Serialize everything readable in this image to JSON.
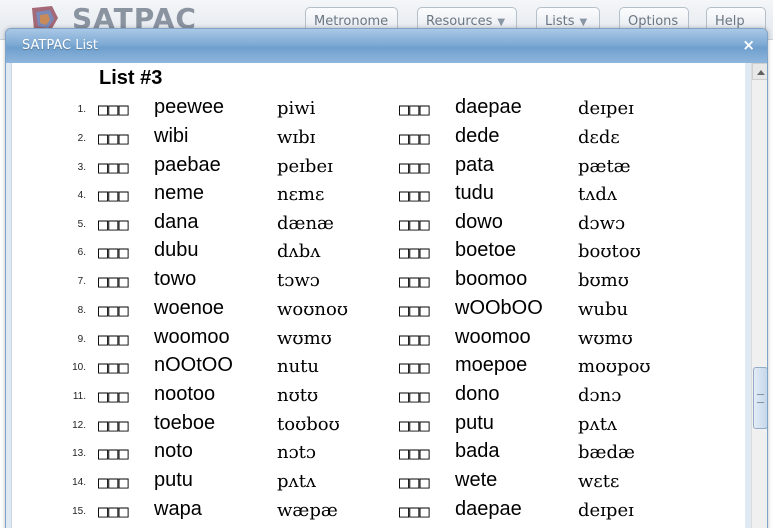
{
  "app": {
    "brand": "SATPAC",
    "nav": [
      {
        "label": "Metronome",
        "caret": ""
      },
      {
        "label": "Resources",
        "caret": "▼"
      },
      {
        "label": "Lists",
        "caret": "▼"
      },
      {
        "label": "Options",
        "caret": ""
      },
      {
        "label": "Help",
        "caret": ""
      }
    ]
  },
  "dialog": {
    "title": "SATPAC List",
    "close_glyph": "×"
  },
  "list": {
    "title": "List #3",
    "box_glyph": "□□□",
    "rows": [
      {
        "num": "1.",
        "w1": "peewee",
        "i1": "piwi",
        "w2": "daepae",
        "i2": "deɪpeɪ"
      },
      {
        "num": "2.",
        "w1": "wibi",
        "i1": "wɪbɪ",
        "w2": "dede",
        "i2": "dɛdɛ"
      },
      {
        "num": "3.",
        "w1": "paebae",
        "i1": "peɪbeɪ",
        "w2": "pata",
        "i2": "pætæ"
      },
      {
        "num": "4.",
        "w1": "neme",
        "i1": "nɛmɛ",
        "w2": "tudu",
        "i2": "tʌdʌ"
      },
      {
        "num": "5.",
        "w1": "dana",
        "i1": "dænæ",
        "w2": "dowo",
        "i2": "dɔwɔ"
      },
      {
        "num": "6.",
        "w1": "dubu",
        "i1": "dʌbʌ",
        "w2": "boetoe",
        "i2": "boʊtoʊ"
      },
      {
        "num": "7.",
        "w1": "towo",
        "i1": "tɔwɔ",
        "w2": "boomoo",
        "i2": "bʊmʊ"
      },
      {
        "num": "8.",
        "w1": "woenoe",
        "i1": "woʊnoʊ",
        "w2": "wOObOO",
        "i2": "wubu"
      },
      {
        "num": "9.",
        "w1": "woomoo",
        "i1": "wʊmʊ",
        "w2": "woomoo",
        "i2": "wʊmʊ"
      },
      {
        "num": "10.",
        "w1": "nOOtOO",
        "i1": "nutu",
        "w2": "moepoe",
        "i2": "moʊpoʊ"
      },
      {
        "num": "11.",
        "w1": "nootoo",
        "i1": "nʊtʊ",
        "w2": "dono",
        "i2": "dɔnɔ"
      },
      {
        "num": "12.",
        "w1": "toeboe",
        "i1": "toʊboʊ",
        "w2": "putu",
        "i2": "pʌtʌ"
      },
      {
        "num": "13.",
        "w1": "noto",
        "i1": "nɔtɔ",
        "w2": "bada",
        "i2": "bædæ"
      },
      {
        "num": "14.",
        "w1": "putu",
        "i1": "pʌtʌ",
        "w2": "wete",
        "i2": "wɛtɛ"
      },
      {
        "num": "15.",
        "w1": "wapa",
        "i1": "wæpæ",
        "w2": "daepae",
        "i2": "deɪpeɪ"
      }
    ]
  }
}
